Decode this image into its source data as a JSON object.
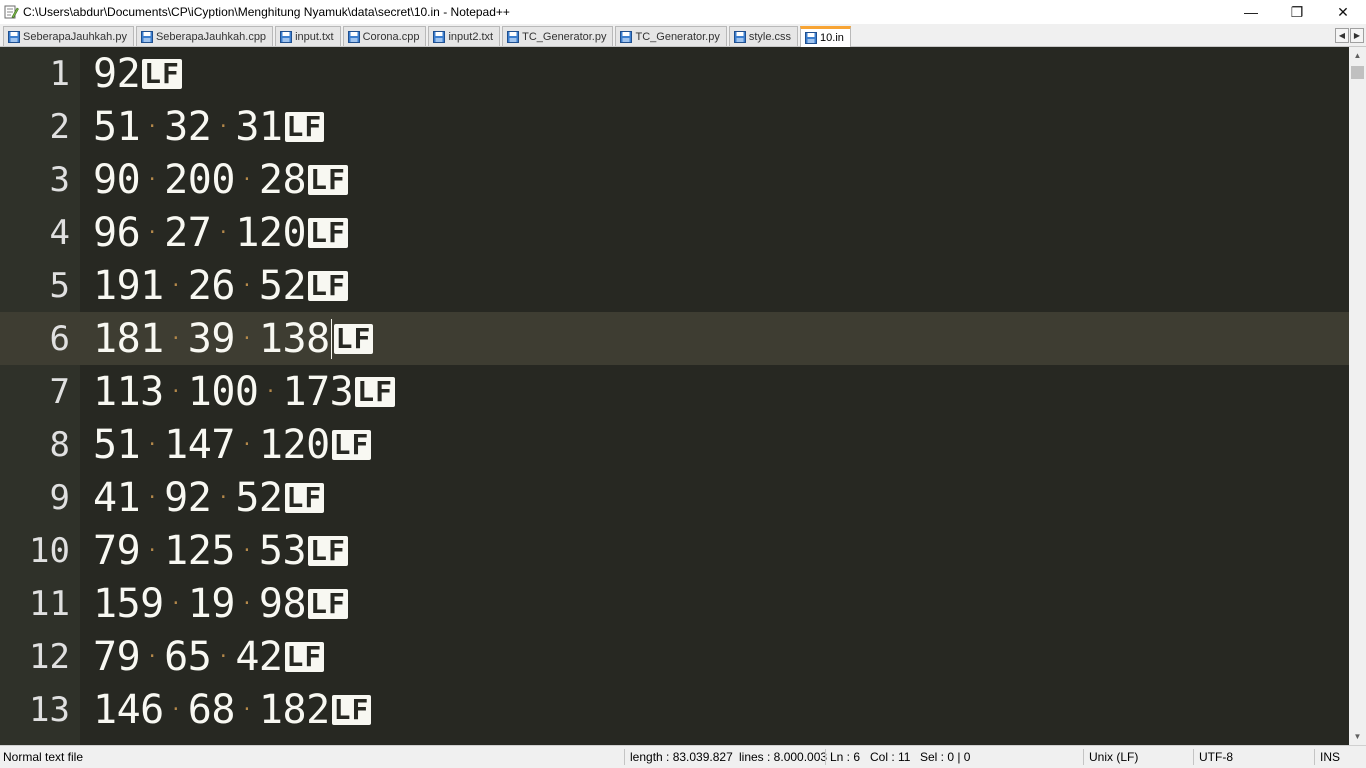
{
  "window": {
    "title": "C:\\Users\\abdur\\Documents\\CP\\iCyption\\Menghitung Nyamuk\\data\\secret\\10.in - Notepad++",
    "controls": {
      "minimize": "—",
      "restore": "❐",
      "close": "✕"
    }
  },
  "tabs": [
    {
      "label": "SeberapaJauhkah.py",
      "active": false
    },
    {
      "label": "SeberapaJauhkah.cpp",
      "active": false
    },
    {
      "label": "input.txt",
      "active": false
    },
    {
      "label": "Corona.cpp",
      "active": false
    },
    {
      "label": "input2.txt",
      "active": false
    },
    {
      "label": "TC_Generator.py",
      "active": false
    },
    {
      "label": "TC_Generator.py",
      "active": false
    },
    {
      "label": "style.css",
      "active": false
    },
    {
      "label": "10.in",
      "active": true
    }
  ],
  "tab_scroll": {
    "left": "◀",
    "right": "▶"
  },
  "editor": {
    "eol_marker": "LF",
    "whitespace_marker": "·",
    "current_line": 6,
    "lines": [
      {
        "number": "1",
        "tokens": [
          "92"
        ]
      },
      {
        "number": "2",
        "tokens": [
          "51",
          "32",
          "31"
        ]
      },
      {
        "number": "3",
        "tokens": [
          "90",
          "200",
          "28"
        ]
      },
      {
        "number": "4",
        "tokens": [
          "96",
          "27",
          "120"
        ]
      },
      {
        "number": "5",
        "tokens": [
          "191",
          "26",
          "52"
        ]
      },
      {
        "number": "6",
        "tokens": [
          "181",
          "39",
          "138"
        ]
      },
      {
        "number": "7",
        "tokens": [
          "113",
          "100",
          "173"
        ]
      },
      {
        "number": "8",
        "tokens": [
          "51",
          "147",
          "120"
        ]
      },
      {
        "number": "9",
        "tokens": [
          "41",
          "92",
          "52"
        ]
      },
      {
        "number": "10",
        "tokens": [
          "79",
          "125",
          "53"
        ]
      },
      {
        "number": "11",
        "tokens": [
          "159",
          "19",
          "98"
        ]
      },
      {
        "number": "12",
        "tokens": [
          "79",
          "65",
          "42"
        ]
      },
      {
        "number": "13",
        "tokens": [
          "146",
          "68",
          "182"
        ]
      }
    ]
  },
  "scrollbar": {
    "up": "▲",
    "down": "▼"
  },
  "statusbar": {
    "file_type": "Normal text file",
    "length": "length : 83.039.827",
    "lines": "lines : 8.000.003",
    "ln": "Ln : 6",
    "col": "Col : 11",
    "sel": "Sel : 0 | 0",
    "eol": "Unix (LF)",
    "encoding": "UTF-8",
    "mode": "INS"
  },
  "colors": {
    "editor_bg": "#272822",
    "current_line_bg": "#3e3d32",
    "text": "#f8f8f2",
    "whitespace_dot": "#b5894a",
    "active_tab_accent": "#f7a434"
  },
  "icons": {
    "app": "notepadpp-icon",
    "tab_file": "saved-file-icon"
  }
}
